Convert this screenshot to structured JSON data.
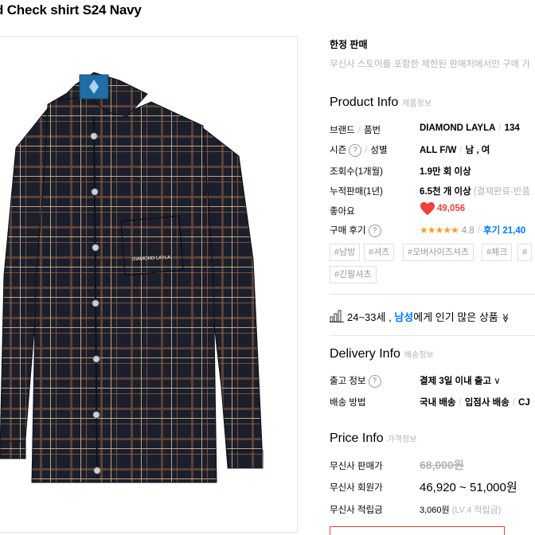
{
  "product": {
    "title": "d Check shirt S24 Navy",
    "pocket_logo": "DIAMOND LAYLA"
  },
  "limited": {
    "title": "한정 판매",
    "desc": "무신사 스토어를 포함한 제한된 판매처에서만 구매 가"
  },
  "product_info": {
    "title": "Product Info",
    "subtitle": "제품정보",
    "brand_label": "브랜드",
    "code_label": "품번",
    "brand_value": "DIAMOND LAYLA",
    "code_value": "134",
    "season_label": "시즌",
    "gender_label": "성별",
    "season_value": "ALL F/W",
    "gender_value": "남 , 여",
    "views_label": "조회수(1개월)",
    "views_value": "1.9만 회 이상",
    "sales_label": "누적판매(1년)",
    "sales_value": "6.5천 개 이상",
    "sales_note": "(결제완료-반품",
    "likes_label": "좋아요",
    "likes_value": "49,056",
    "review_label": "구매 후기",
    "stars": "★★★★★",
    "rating": "4.8",
    "reviews": "후기 21,40"
  },
  "tags": [
    "#남방",
    "#셔츠",
    "#오버사이즈셔츠",
    "#체크",
    "#",
    "#긴팔셔츠"
  ],
  "popular": {
    "age": "24~33세 ,",
    "gender": "남성",
    "suffix": "에게 인기 많은 상품"
  },
  "delivery_info": {
    "title": "Delivery Info",
    "subtitle": "배송정보",
    "ship_label": "출고 정보",
    "ship_value": "결제 3일 이내 출고",
    "method_label": "배송 방법",
    "method_1": "국내 배송",
    "method_2": "입점사 배송",
    "method_3": "CJ"
  },
  "price_info": {
    "title": "Price Info",
    "subtitle": "가격정보",
    "sale_label": "무신사 판매가",
    "sale_value": "68,000원",
    "member_label": "무신사 회원가",
    "member_value": "46,920 ~ 51,000원",
    "points_label": "무신사 적립금",
    "points_value": "3,060원",
    "points_note": "(LV.4 적립금)"
  },
  "colors": {
    "accent_blue": "#0078ff",
    "like_red": "#f03e3e",
    "star_orange": "#f6a020",
    "shirt_navy": "#1b1f2b"
  },
  "icons": {
    "question": "?",
    "chevron_down": "∨",
    "double_chevron": "≫"
  }
}
